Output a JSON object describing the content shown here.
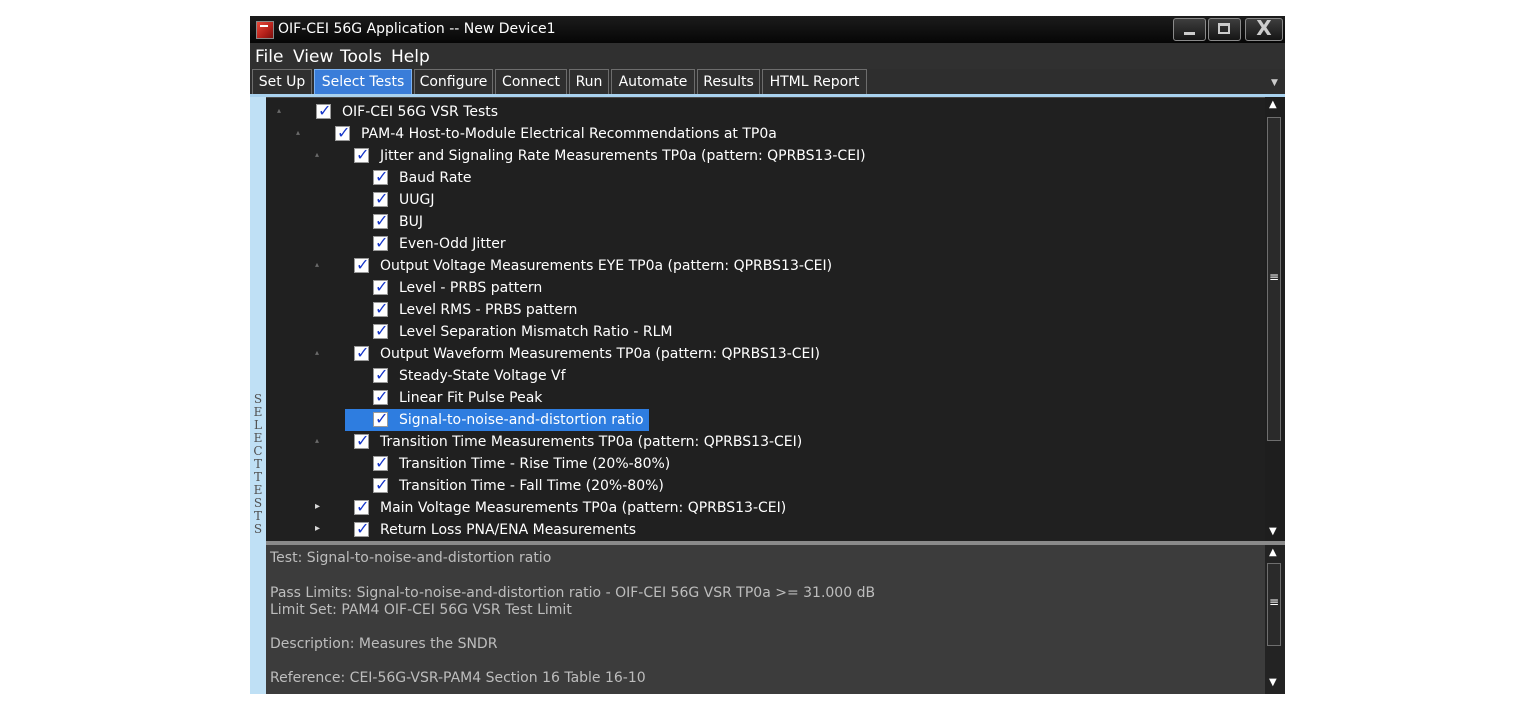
{
  "window": {
    "title": "OIF-CEI 56G Application -- New Device1",
    "controls": {
      "minimize": "minimize",
      "maximize": "maximize",
      "close": "X"
    }
  },
  "menu": [
    "File",
    "View",
    "Tools",
    "Help"
  ],
  "tabs": [
    {
      "label": "Set Up",
      "active": false
    },
    {
      "label": "Select Tests",
      "active": true
    },
    {
      "label": "Configure",
      "active": false
    },
    {
      "label": "Connect",
      "active": false
    },
    {
      "label": "Run",
      "active": false
    },
    {
      "label": "Automate",
      "active": false
    },
    {
      "label": "Results",
      "active": false
    },
    {
      "label": "HTML Report",
      "active": false
    }
  ],
  "sidebar": {
    "label": "SELECT TESTS"
  },
  "tree": [
    {
      "label": "OIF-CEI 56G VSR Tests",
      "checked": true,
      "expander": "expanded"
    },
    {
      "label": "PAM-4 Host-to-Module Electrical Recommendations at TP0a",
      "checked": true,
      "expander": "expanded"
    },
    {
      "label": "Jitter and Signaling Rate Measurements TP0a (pattern: QPRBS13-CEI)",
      "checked": true,
      "expander": "expanded"
    },
    {
      "label": "Baud Rate",
      "checked": true,
      "expander": "none"
    },
    {
      "label": "UUGJ",
      "checked": true,
      "expander": "none"
    },
    {
      "label": "BUJ",
      "checked": true,
      "expander": "none"
    },
    {
      "label": "Even-Odd Jitter",
      "checked": true,
      "expander": "none"
    },
    {
      "label": "Output Voltage Measurements EYE TP0a (pattern: QPRBS13-CEI)",
      "checked": true,
      "expander": "expanded"
    },
    {
      "label": "Level - PRBS pattern",
      "checked": true,
      "expander": "none"
    },
    {
      "label": "Level RMS - PRBS pattern",
      "checked": true,
      "expander": "none"
    },
    {
      "label": "Level Separation Mismatch Ratio - RLM",
      "checked": true,
      "expander": "none"
    },
    {
      "label": "Output Waveform Measurements TP0a (pattern: QPRBS13-CEI)",
      "checked": true,
      "expander": "expanded"
    },
    {
      "label": "Steady-State Voltage Vf",
      "checked": true,
      "expander": "none"
    },
    {
      "label": "Linear Fit Pulse Peak",
      "checked": true,
      "expander": "none"
    },
    {
      "label": "Signal-to-noise-and-distortion ratio",
      "checked": true,
      "expander": "none",
      "selected": true
    },
    {
      "label": "Transition Time Measurements TP0a (pattern: QPRBS13-CEI)",
      "checked": true,
      "expander": "expanded"
    },
    {
      "label": "Transition Time -  Rise Time (20%-80%)",
      "checked": true,
      "expander": "none"
    },
    {
      "label": "Transition Time - Fall Time (20%-80%)",
      "checked": true,
      "expander": "none"
    },
    {
      "label": "Main Voltage Measurements TP0a (pattern: QPRBS13-CEI)",
      "checked": true,
      "expander": "collapsed"
    },
    {
      "label": "Return Loss PNA/ENA Measurements",
      "checked": true,
      "expander": "collapsed"
    }
  ],
  "details": {
    "test": "Test: Signal-to-noise-and-distortion ratio",
    "pass_limits": "Pass Limits: Signal-to-noise-and-distortion ratio - OIF-CEI 56G VSR TP0a >= 31.000 dB",
    "limit_set": "Limit Set: PAM4 OIF-CEI 56G VSR Test Limit",
    "description": "Description: Measures the SNDR",
    "reference": "Reference: CEI-56G-VSR-PAM4 Section 16 Table 16-10"
  },
  "icons": {
    "expanded": "▴",
    "collapsed": "▸",
    "scroll_up": "▲",
    "scroll_down": "▼",
    "grip": "≡",
    "tab_overflow": "▼"
  }
}
